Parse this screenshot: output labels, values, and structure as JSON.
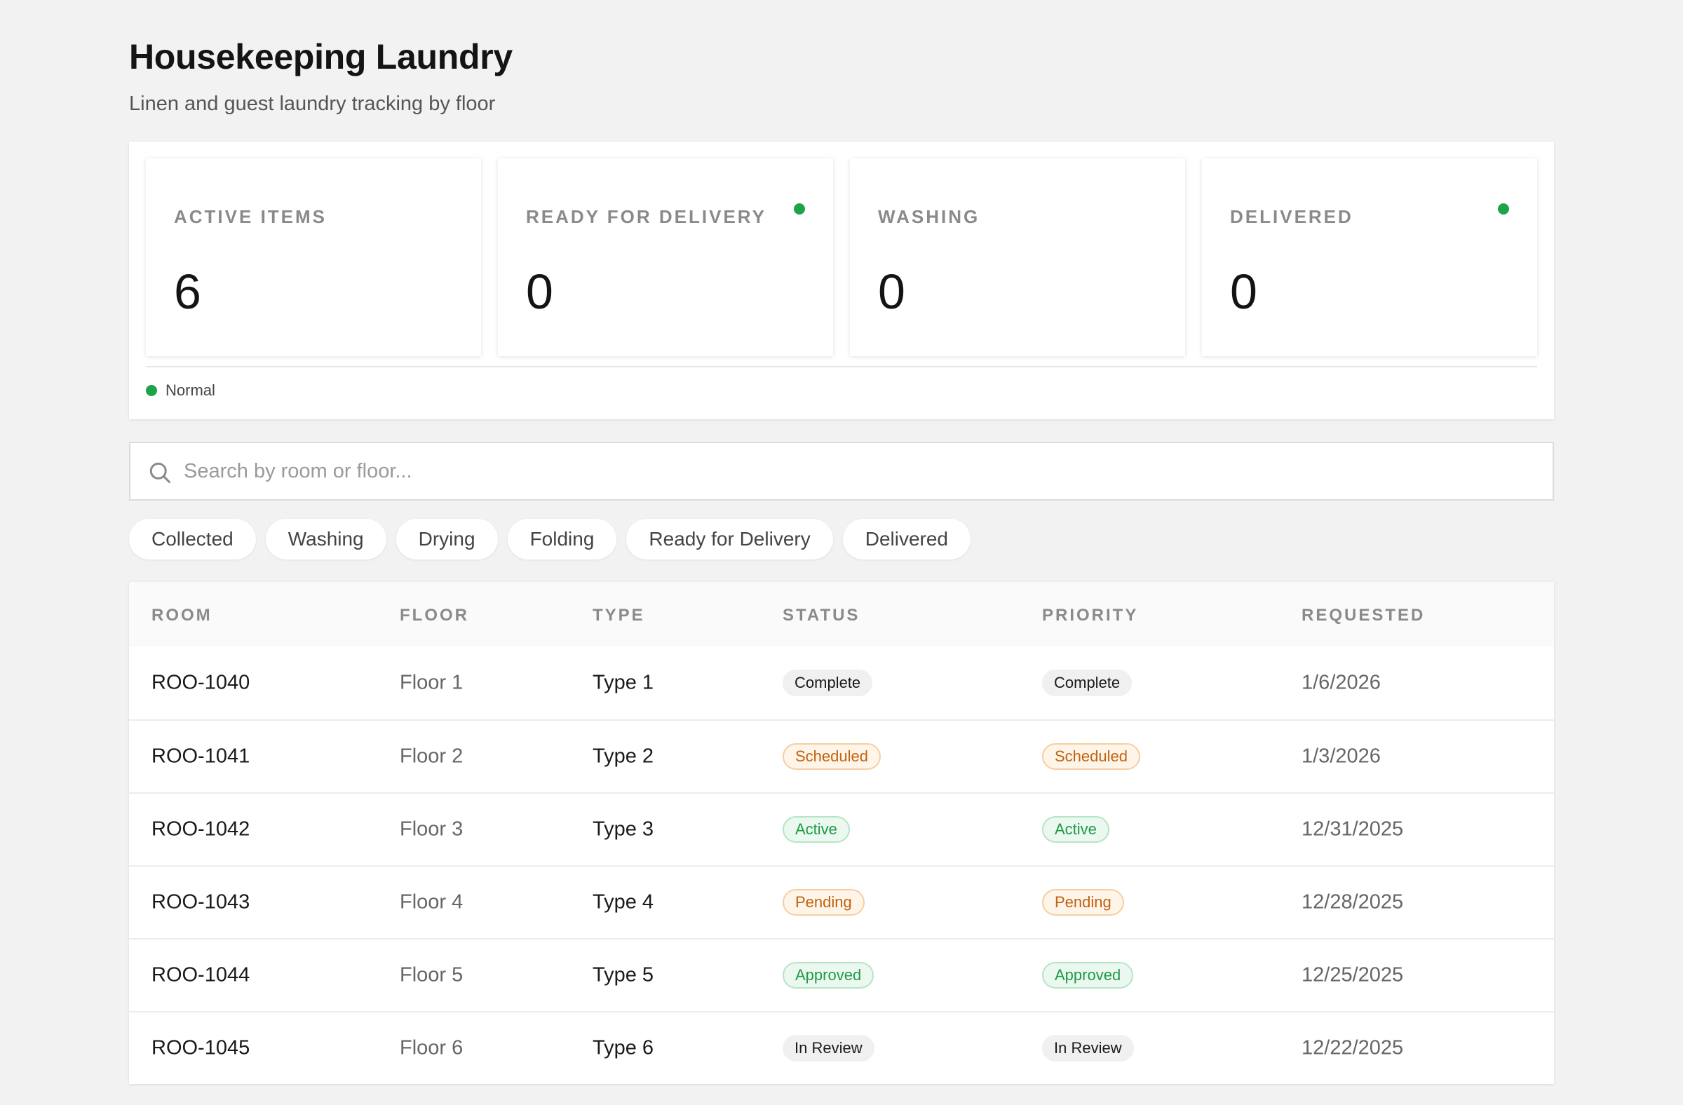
{
  "header": {
    "title": "Housekeeping Laundry",
    "subtitle": "Linen and guest laundry tracking by floor"
  },
  "stats": [
    {
      "label": "ACTIVE ITEMS",
      "value": "6",
      "dot": false
    },
    {
      "label": "READY FOR DELIVERY",
      "value": "0",
      "dot": true
    },
    {
      "label": "WASHING",
      "value": "0",
      "dot": false
    },
    {
      "label": "DELIVERED",
      "value": "0",
      "dot": true
    }
  ],
  "legend": {
    "label": "Normal",
    "color": "#1ea34a"
  },
  "search": {
    "placeholder": "Search by room or floor...",
    "value": ""
  },
  "filters": [
    "Collected",
    "Washing",
    "Drying",
    "Folding",
    "Ready for Delivery",
    "Delivered"
  ],
  "table": {
    "columns": [
      "ROOM",
      "FLOOR",
      "TYPE",
      "STATUS",
      "PRIORITY",
      "REQUESTED"
    ],
    "rows": [
      {
        "room": "ROO-1040",
        "floor": "Floor 1",
        "type": "Type 1",
        "status": "Complete",
        "priority": "Complete",
        "requested": "1/6/2026",
        "tone": "neutral"
      },
      {
        "room": "ROO-1041",
        "floor": "Floor 2",
        "type": "Type 2",
        "status": "Scheduled",
        "priority": "Scheduled",
        "requested": "1/3/2026",
        "tone": "orange"
      },
      {
        "room": "ROO-1042",
        "floor": "Floor 3",
        "type": "Type 3",
        "status": "Active",
        "priority": "Active",
        "requested": "12/31/2025",
        "tone": "green"
      },
      {
        "room": "ROO-1043",
        "floor": "Floor 4",
        "type": "Type 4",
        "status": "Pending",
        "priority": "Pending",
        "requested": "12/28/2025",
        "tone": "orange"
      },
      {
        "room": "ROO-1044",
        "floor": "Floor 5",
        "type": "Type 5",
        "status": "Approved",
        "priority": "Approved",
        "requested": "12/25/2025",
        "tone": "green"
      },
      {
        "room": "ROO-1045",
        "floor": "Floor 6",
        "type": "Type 6",
        "status": "In Review",
        "priority": "In Review",
        "requested": "12/22/2025",
        "tone": "neutral"
      }
    ]
  },
  "colors": {
    "accent_green": "#1ea34a",
    "badge_orange": "#c0620f",
    "badge_green": "#1e9a46"
  },
  "icons": {
    "search": "search-icon",
    "status_dot": "status-dot-icon"
  }
}
